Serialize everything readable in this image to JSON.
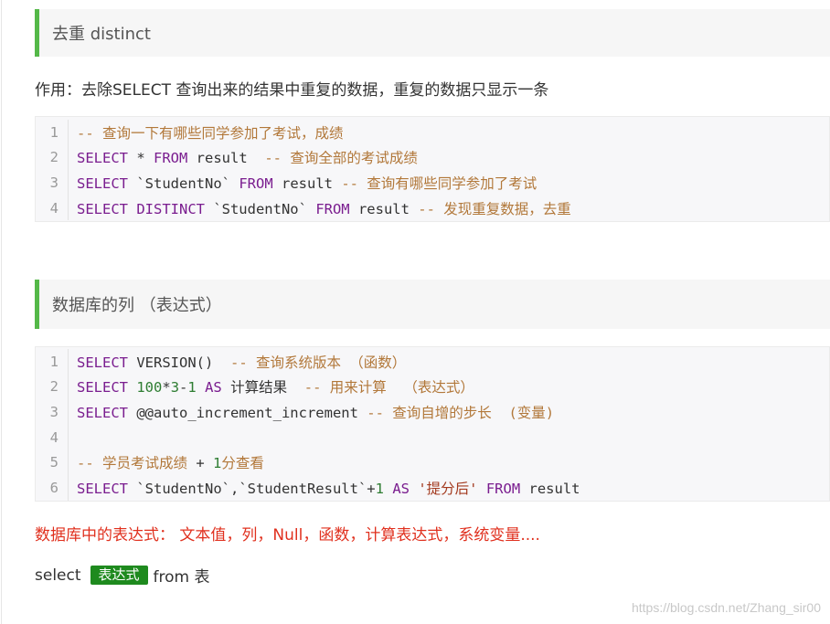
{
  "section1": {
    "heading": "去重  distinct",
    "description": "作用：去除SELECT 查询出来的结果中重复的数据，重复的数据只显示一条",
    "code_lines": [
      {
        "n": "1",
        "tokens": [
          {
            "t": "cm",
            "v": "-- 查询一下有哪些同学参加了考试，成绩"
          }
        ]
      },
      {
        "n": "2",
        "tokens": [
          {
            "t": "kw",
            "v": "SELECT"
          },
          {
            "t": "tx",
            "v": " * "
          },
          {
            "t": "kw",
            "v": "FROM"
          },
          {
            "t": "tx",
            "v": " result  "
          },
          {
            "t": "cm",
            "v": "-- 查询全部的考试成绩"
          }
        ]
      },
      {
        "n": "3",
        "tokens": [
          {
            "t": "kw",
            "v": "SELECT"
          },
          {
            "t": "tx",
            "v": " `StudentNo` "
          },
          {
            "t": "kw",
            "v": "FROM"
          },
          {
            "t": "tx",
            "v": " result "
          },
          {
            "t": "cm",
            "v": "-- 查询有哪些同学参加了考试"
          }
        ]
      },
      {
        "n": "4",
        "tokens": [
          {
            "t": "kw",
            "v": "SELECT DISTINCT"
          },
          {
            "t": "tx",
            "v": " `StudentNo` "
          },
          {
            "t": "kw",
            "v": "FROM"
          },
          {
            "t": "tx",
            "v": " result "
          },
          {
            "t": "cm",
            "v": "-- 发现重复数据，去重"
          }
        ]
      }
    ]
  },
  "section2": {
    "heading": "数据库的列 （表达式）",
    "code_lines": [
      {
        "n": "1",
        "tokens": [
          {
            "t": "kw",
            "v": "SELECT"
          },
          {
            "t": "tx",
            "v": " VERSION()  "
          },
          {
            "t": "cm",
            "v": "-- 查询系统版本 （函数）"
          }
        ]
      },
      {
        "n": "2",
        "tokens": [
          {
            "t": "kw",
            "v": "SELECT"
          },
          {
            "t": "tx",
            "v": " "
          },
          {
            "t": "num",
            "v": "100"
          },
          {
            "t": "tx",
            "v": "*"
          },
          {
            "t": "num",
            "v": "3"
          },
          {
            "t": "tx",
            "v": "-"
          },
          {
            "t": "num",
            "v": "1"
          },
          {
            "t": "tx",
            "v": " "
          },
          {
            "t": "kw",
            "v": "AS"
          },
          {
            "t": "tx",
            "v": " 计算结果  "
          },
          {
            "t": "cm",
            "v": "-- 用来计算  （表达式）"
          }
        ]
      },
      {
        "n": "3",
        "tokens": [
          {
            "t": "kw",
            "v": "SELECT"
          },
          {
            "t": "tx",
            "v": " @@auto_increment_increment "
          },
          {
            "t": "cm",
            "v": "-- 查询自增的步长  (变量)"
          }
        ]
      },
      {
        "n": "4",
        "tokens": []
      },
      {
        "n": "5",
        "tokens": [
          {
            "t": "cm",
            "v": "-- 学员考试成绩 "
          },
          {
            "t": "tx",
            "v": "+ "
          },
          {
            "t": "num",
            "v": "1"
          },
          {
            "t": "cm",
            "v": "分查看"
          }
        ]
      },
      {
        "n": "6",
        "tokens": [
          {
            "t": "kw",
            "v": "SELECT"
          },
          {
            "t": "tx",
            "v": " `StudentNo`,`StudentResult`+"
          },
          {
            "t": "num",
            "v": "1"
          },
          {
            "t": "tx",
            "v": " "
          },
          {
            "t": "kw",
            "v": "AS"
          },
          {
            "t": "tx",
            "v": " "
          },
          {
            "t": "str",
            "v": "'提分后'"
          },
          {
            "t": "tx",
            "v": " "
          },
          {
            "t": "kw",
            "v": "FROM"
          },
          {
            "t": "tx",
            "v": " result"
          }
        ]
      }
    ]
  },
  "note": "数据库中的表达式： 文本值，列，Null，函数，计算表达式，系统变量....",
  "select_line": {
    "prefix": "select",
    "badge": "表达式",
    "suffix": "from 表"
  },
  "watermark": "https://blog.csdn.net/Zhang_sir00",
  "colors": {
    "accent_border": "#54b848",
    "keyword": "#7a1d8f",
    "comment": "#b2783a",
    "number": "#2e7d32",
    "note": "#e0301e",
    "badge_bg": "#1e8a1e"
  },
  "icons": {
    "cursor": "text-cursor-icon"
  }
}
